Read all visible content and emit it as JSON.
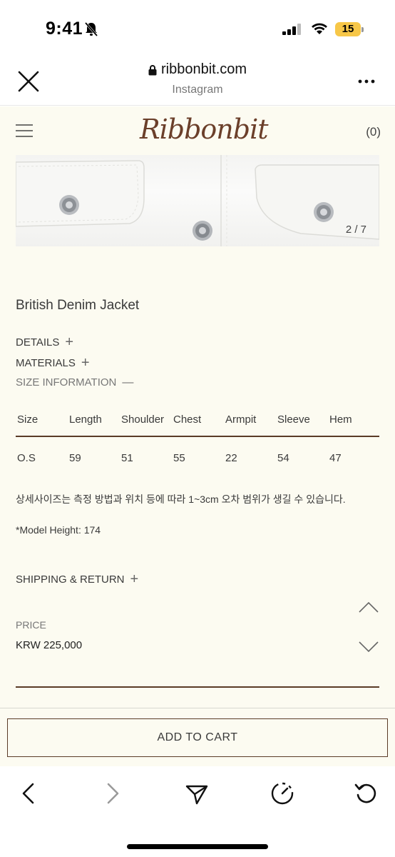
{
  "status_bar": {
    "time": "9:41",
    "battery": "15"
  },
  "browser": {
    "url": "ribbonbit.com",
    "subtitle": "Instagram"
  },
  "site": {
    "logo": "Ribbonbit",
    "cart_count": "(0)"
  },
  "gallery": {
    "indicator": "2 / 7"
  },
  "product": {
    "title": "British Denim Jacket"
  },
  "accordion": {
    "details": "DETAILS",
    "materials": "MATERIALS",
    "size_info": "SIZE INFORMATION",
    "shipping": "SHIPPING & RETURN",
    "plus": "+",
    "minus": "—"
  },
  "size_table": {
    "headers": [
      "Size",
      "Length",
      "Shoulder",
      "Chest",
      "Armpit",
      "Sleeve",
      "Hem"
    ],
    "rows": [
      [
        "O.S",
        "59",
        "51",
        "55",
        "22",
        "54",
        "47"
      ]
    ]
  },
  "notes": {
    "measurement": "상세사이즈는 측정 방법과 위치 등에 따라 1~3cm 오차 범위가 생길 수 있습니다.",
    "model_height": "*Model Height: 174"
  },
  "price": {
    "label": "PRICE",
    "value": "KRW 225,000"
  },
  "cart": {
    "add_label": "ADD TO CART"
  },
  "icons": {
    "close": "close-icon",
    "lock": "lock-icon",
    "more": "more-icon",
    "menu": "menu-icon",
    "back": "chevron-left-icon",
    "forward": "chevron-right-icon",
    "share": "send-icon",
    "speed": "gauge-icon",
    "reload": "reload-icon"
  }
}
